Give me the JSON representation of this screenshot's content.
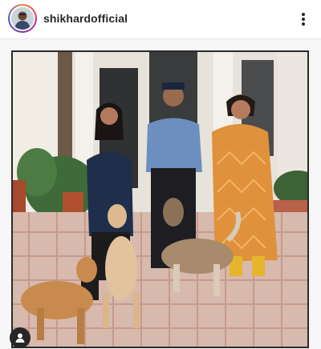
{
  "post": {
    "username": "shikhardofficial",
    "more_icon": "more-vertical-icon",
    "tag_icon": "user-tag-icon"
  },
  "colors": {
    "username": "#262626",
    "divider": "#e6e6e6",
    "photo_border": "#2a2a2a"
  }
}
